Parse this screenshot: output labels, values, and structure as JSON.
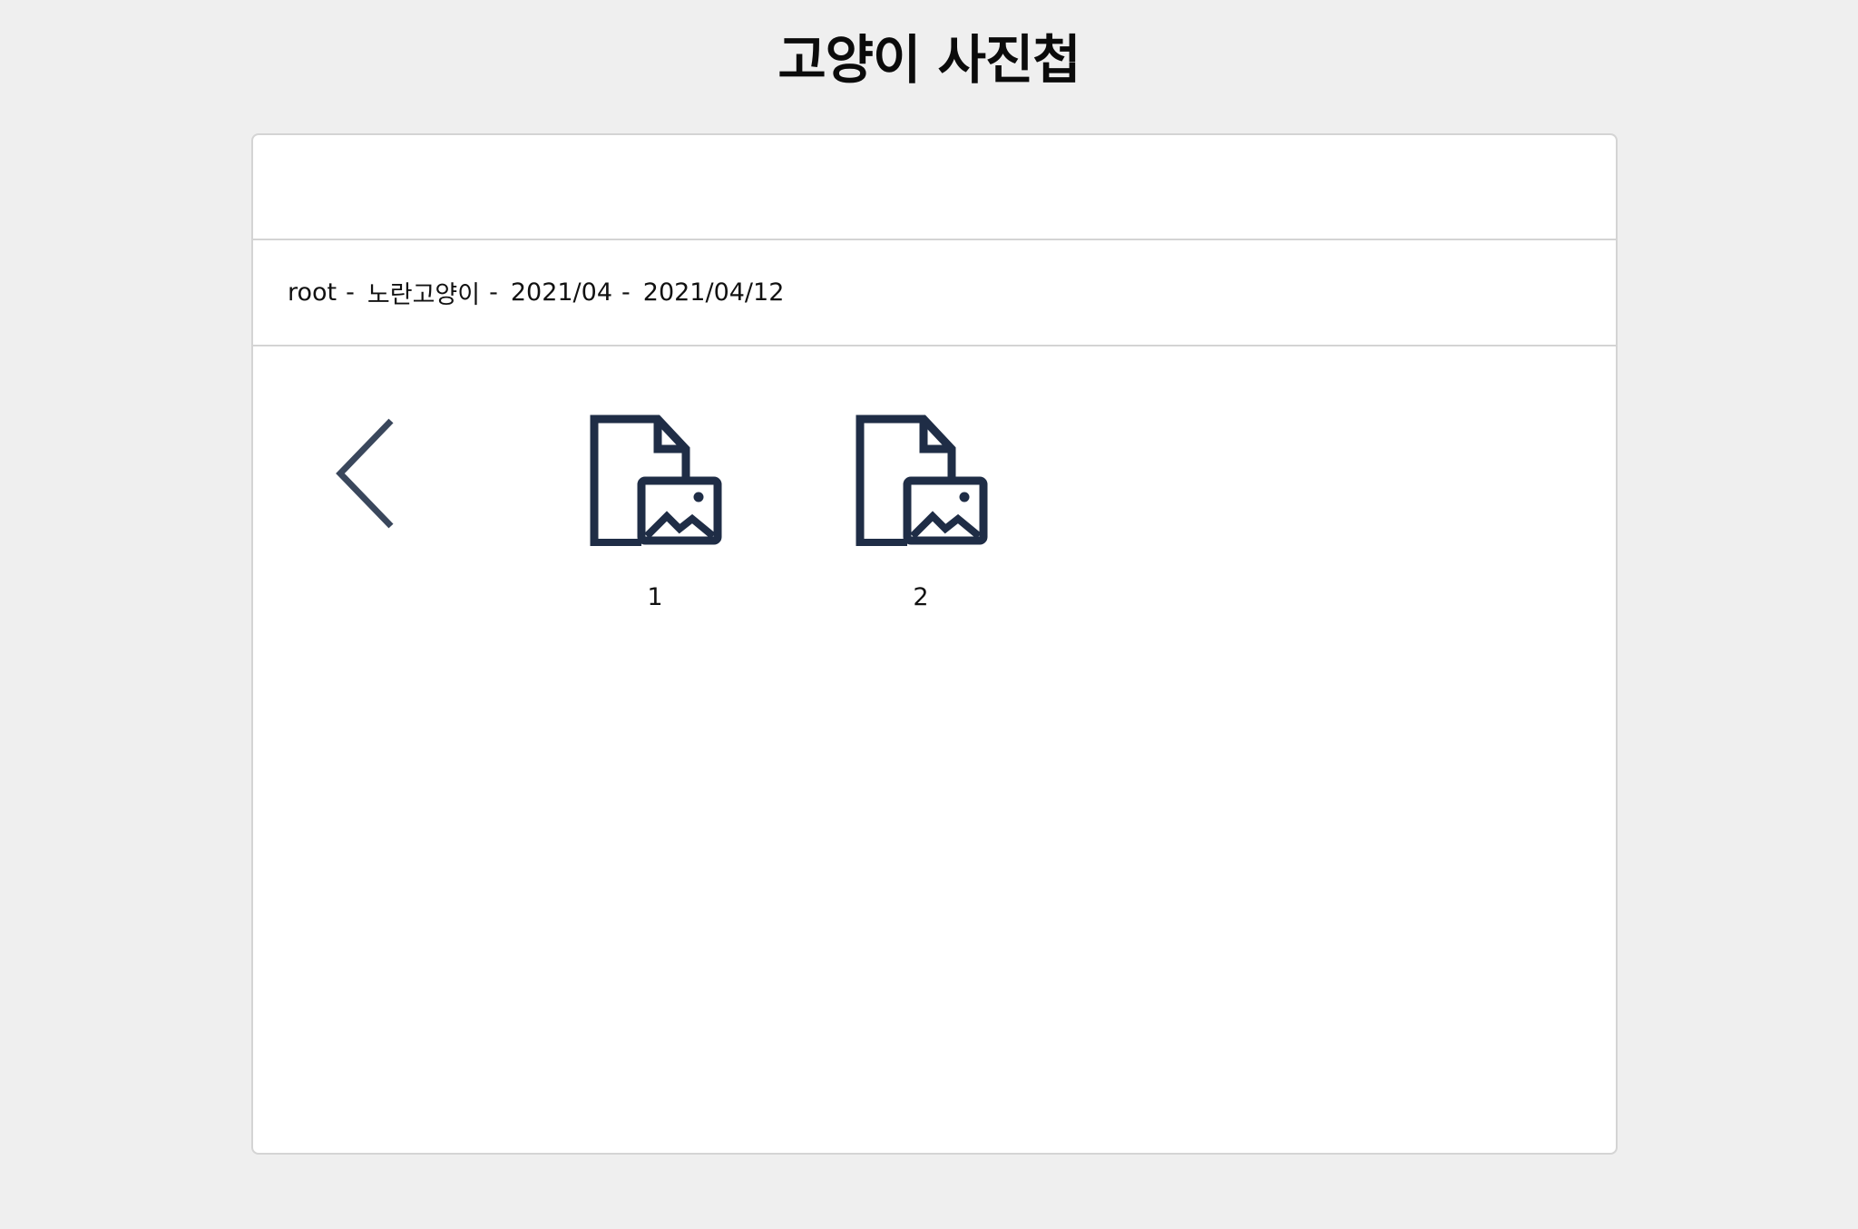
{
  "page": {
    "title": "고양이 사진첩"
  },
  "breadcrumb": {
    "items": [
      {
        "label": "root",
        "separator": " - "
      },
      {
        "label": "노란고양이",
        "separator": " - "
      },
      {
        "label": "2021/04",
        "separator": " - "
      },
      {
        "label": "2021/04/12",
        "separator": ""
      }
    ]
  },
  "nodes": [
    {
      "label": "1",
      "icon": "image-file-icon"
    },
    {
      "label": "2",
      "icon": "image-file-icon"
    }
  ],
  "colors": {
    "icon": "#1f2d46",
    "background": "#efefef",
    "panel": "#ffffff",
    "border": "#d4d4d4"
  }
}
